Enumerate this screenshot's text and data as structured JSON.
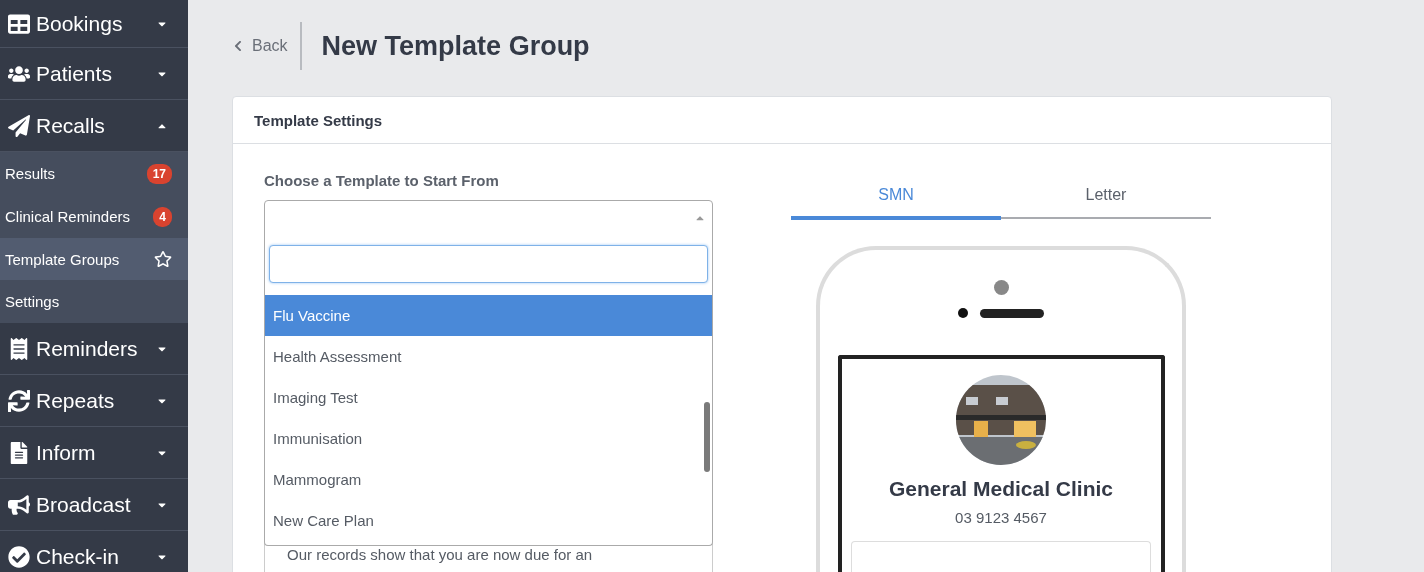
{
  "sidebar": {
    "items": [
      {
        "label": "Bookings",
        "expanded": false
      },
      {
        "label": "Patients",
        "expanded": false
      },
      {
        "label": "Recalls",
        "expanded": true,
        "children": [
          {
            "label": "Results",
            "badge": "17",
            "selected": false
          },
          {
            "label": "Clinical Reminders",
            "badge": "4",
            "selected": false
          },
          {
            "label": "Template Groups",
            "selected": true
          },
          {
            "label": "Settings",
            "selected": false
          }
        ]
      },
      {
        "label": "Reminders",
        "expanded": false
      },
      {
        "label": "Repeats",
        "expanded": false
      },
      {
        "label": "Inform",
        "expanded": false
      },
      {
        "label": "Broadcast",
        "expanded": false
      },
      {
        "label": "Check-in",
        "expanded": false
      }
    ]
  },
  "header": {
    "back": "Back",
    "title": "New Template Group"
  },
  "card": {
    "title": "Template Settings",
    "template_select": {
      "label": "Choose a Template to Start From",
      "open": true,
      "options": [
        {
          "label": "Flu Vaccine",
          "selected": true
        },
        {
          "label": "Health Assessment",
          "selected": false
        },
        {
          "label": "Imaging Test",
          "selected": false
        },
        {
          "label": "Immunisation",
          "selected": false
        },
        {
          "label": "Mammogram",
          "selected": false
        },
        {
          "label": "New Care Plan",
          "selected": false
        }
      ]
    },
    "message": "Our records show that you are now due for an",
    "tabs": [
      {
        "label": "SMN",
        "selected": true
      },
      {
        "label": "Letter",
        "selected": false
      }
    ],
    "preview": {
      "clinic_name": "General Medical Clinic",
      "phone": "03 9123 4567"
    }
  }
}
